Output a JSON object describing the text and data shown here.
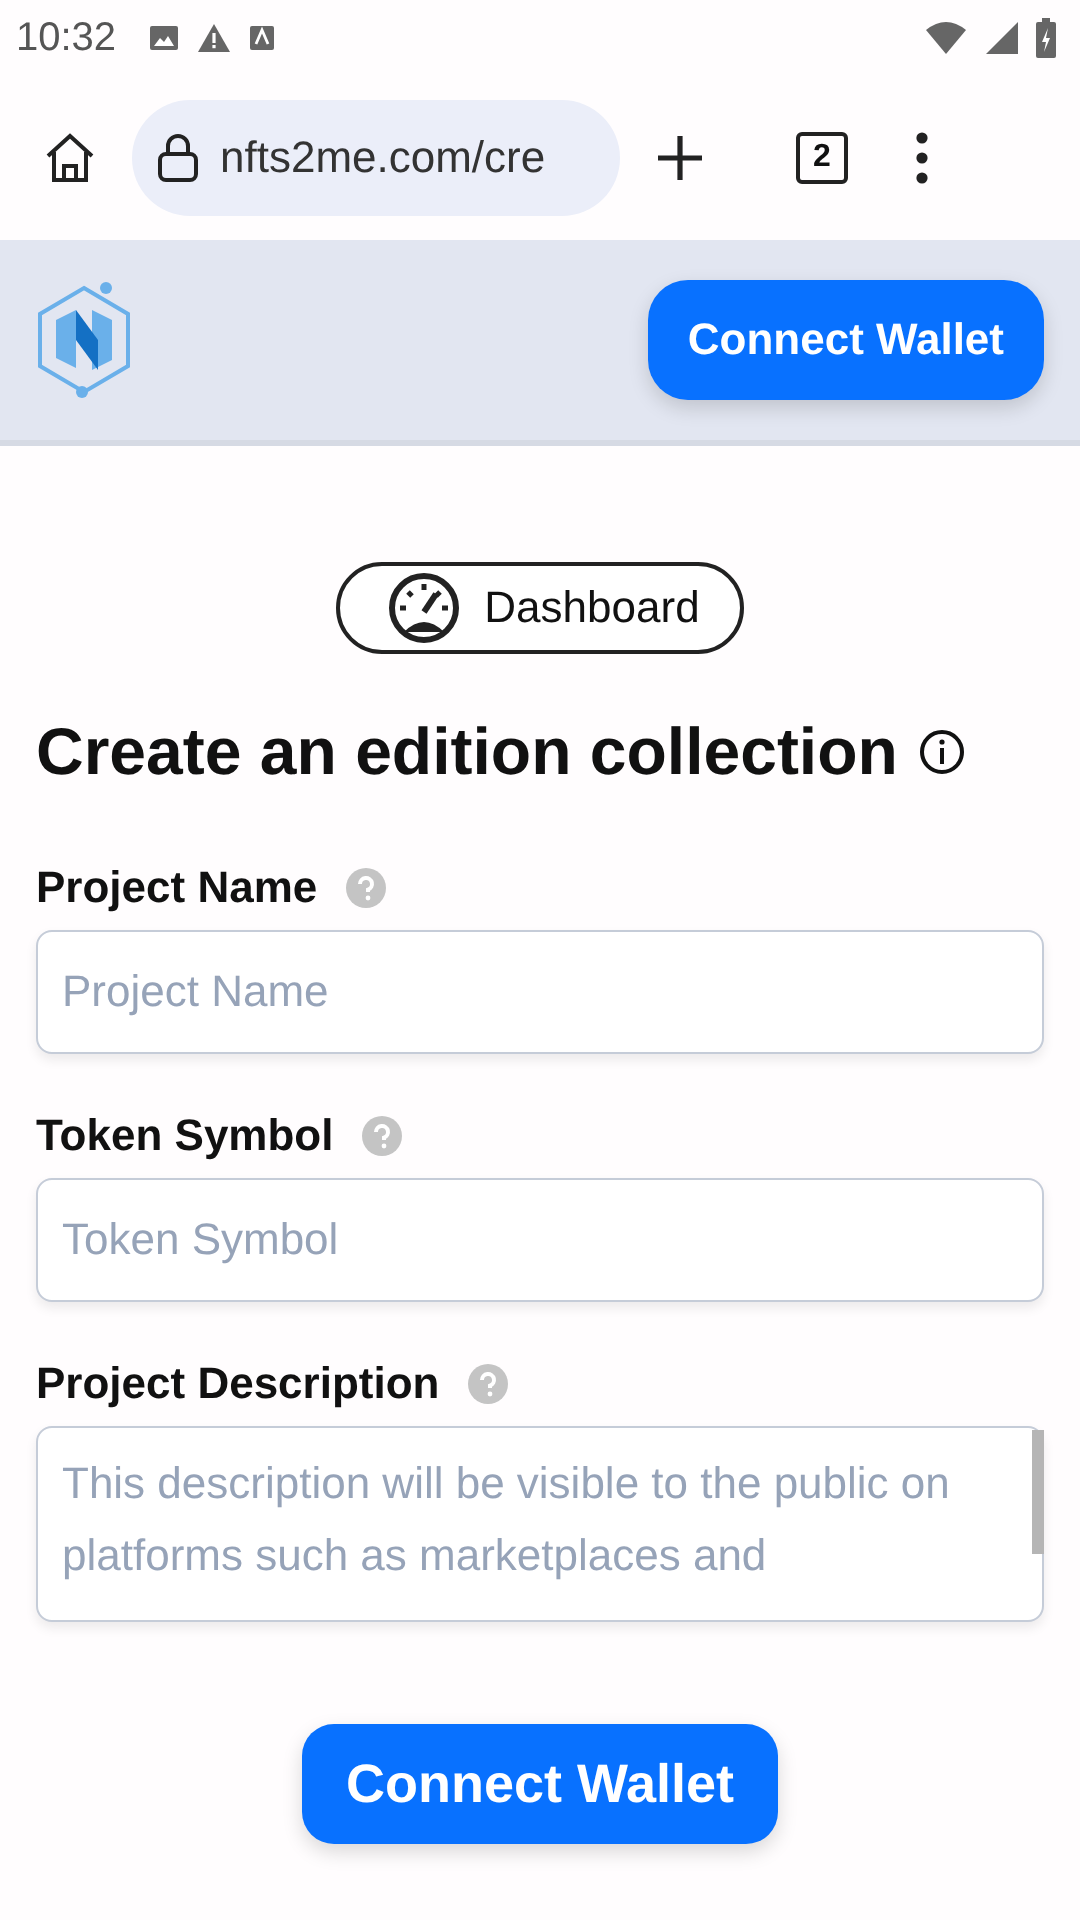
{
  "status_bar": {
    "time": "10:32"
  },
  "browser": {
    "url": "nfts2me.com/cre",
    "tab_count": "2"
  },
  "header": {
    "button": "Connect Wallet"
  },
  "dashboard_link": "Dashboard",
  "title": "Create an edition collection",
  "fields": [
    {
      "kind": "input",
      "label": "Project Name",
      "placeholder": "Project Name"
    },
    {
      "kind": "input",
      "label": "Token Symbol",
      "placeholder": "Token Symbol"
    },
    {
      "kind": "textarea",
      "label": "Project Description",
      "placeholder": "This description will be visible to the public on platforms such as marketplaces and"
    }
  ],
  "submit_button": "Connect Wallet"
}
